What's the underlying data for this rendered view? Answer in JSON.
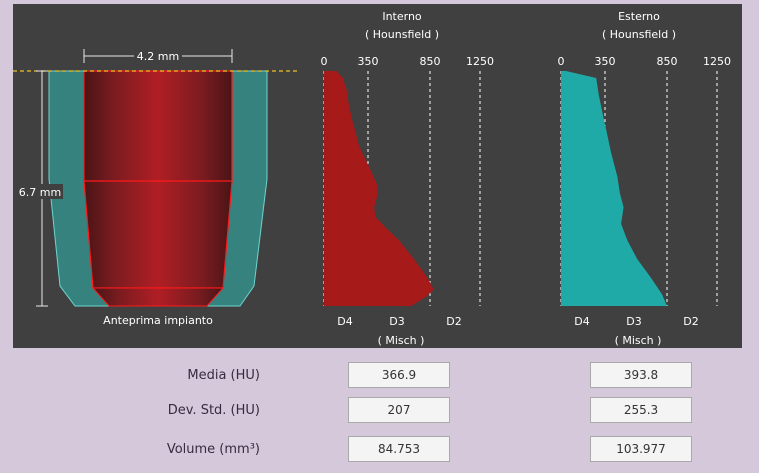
{
  "colors": {
    "panel_bg": "#404040",
    "page_bg": "#d5c8da",
    "interno_fill": "#a71a1a",
    "esterno_fill": "#1faaa8",
    "implant_red": "#b01e24",
    "implant_border": "#ff1a1a",
    "bone_teal": "#2fa6a0",
    "crest_line": "#f0c020"
  },
  "preview": {
    "width_label": "4.2 mm",
    "height_label": "6.7 mm",
    "caption": "Anteprima impianto"
  },
  "charts": {
    "interno": {
      "title": "Interno",
      "subtitle": "( Hounsfield )",
      "ticks": [
        "0",
        "350",
        "850",
        "1250"
      ],
      "tick_values": [
        0,
        350,
        850,
        1250
      ],
      "density_labels": [
        "D4",
        "D3",
        "D2"
      ],
      "misch_label": "( Misch )"
    },
    "esterno": {
      "title": "Esterno",
      "subtitle": "( Hounsfield )",
      "ticks": [
        "0",
        "350",
        "850",
        "1250"
      ],
      "tick_values": [
        0,
        350,
        850,
        1250
      ],
      "density_labels": [
        "D4",
        "D3",
        "D2"
      ],
      "misch_label": "( Misch )"
    }
  },
  "chart_data": [
    {
      "type": "area",
      "title": "Interno",
      "xlabel": "( Hounsfield )",
      "xlim": [
        0,
        1250
      ],
      "depth_fraction": [
        0,
        0.03,
        0.08,
        0.15,
        0.22,
        0.32,
        0.42,
        0.48,
        0.52,
        0.58,
        0.62,
        0.67,
        0.72,
        0.8,
        0.88,
        0.93,
        0.96,
        1.0
      ],
      "hu": [
        100,
        150,
        180,
        200,
        230,
        280,
        370,
        420,
        430,
        400,
        410,
        500,
        600,
        720,
        830,
        880,
        820,
        700
      ]
    },
    {
      "type": "area",
      "title": "Esterno",
      "xlabel": "( Hounsfield )",
      "xlim": [
        0,
        1250
      ],
      "depth_fraction": [
        0,
        0.03,
        0.1,
        0.18,
        0.25,
        0.35,
        0.45,
        0.52,
        0.58,
        0.65,
        0.72,
        0.8,
        0.88,
        0.95,
        1.0
      ],
      "hu": [
        40,
        280,
        300,
        330,
        360,
        400,
        450,
        470,
        500,
        480,
        530,
        610,
        720,
        810,
        850
      ]
    }
  ],
  "stats": {
    "media": {
      "label": "Media (HU)",
      "interno": "366.9",
      "esterno": "393.8"
    },
    "dev_std": {
      "label": "Dev. Std. (HU)",
      "interno": "207",
      "esterno": "255.3"
    },
    "volume": {
      "label": "Volume (mm³)",
      "interno": "84.753",
      "esterno": "103.977"
    }
  }
}
